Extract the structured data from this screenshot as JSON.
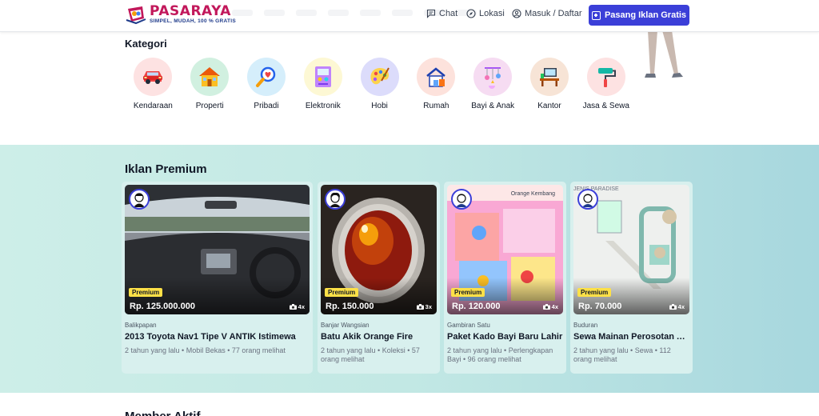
{
  "header": {
    "logo_title": "PASARAYA",
    "logo_tagline": "SIMPEL, MUDAH, 100 % GRATIS",
    "chat": "Chat",
    "lokasi": "Lokasi",
    "login": "Masuk / Daftar",
    "cta": "Pasang Iklan Gratis"
  },
  "kategori": {
    "title": "Kategori",
    "items": [
      {
        "label": "Kendaraan",
        "icon": "car-icon"
      },
      {
        "label": "Properti",
        "icon": "house-icon"
      },
      {
        "label": "Pribadi",
        "icon": "magnifier-heart-icon"
      },
      {
        "label": "Elektronik",
        "icon": "electronics-icon"
      },
      {
        "label": "Hobi",
        "icon": "palette-icon"
      },
      {
        "label": "Rumah",
        "icon": "home-tools-icon"
      },
      {
        "label": "Bayi & Anak",
        "icon": "baby-mobile-icon"
      },
      {
        "label": "Kantor",
        "icon": "desk-icon"
      },
      {
        "label": "Jasa & Sewa",
        "icon": "paint-roller-icon"
      }
    ]
  },
  "premium": {
    "title": "Iklan Premium",
    "cards": [
      {
        "badge": "Premium",
        "price": "Rp. 125.000.000",
        "photos": "4x",
        "location": "Balikpapan",
        "title": "2013 Toyota Nav1 Tipe V ANTIK Istimewa",
        "meta": "2 tahun yang lalu • Mobil Bekas • 77 orang melihat"
      },
      {
        "badge": "Premium",
        "price": "Rp. 150.000",
        "photos": "3x",
        "location": "Banjar Wangsian",
        "title": "Batu Akik Orange Fire",
        "meta": "2 tahun yang lalu • Koleksi • 57 orang melihat"
      },
      {
        "badge": "Premium",
        "price": "Rp. 120.000",
        "photos": "4x",
        "location": "Gambiran Satu",
        "title": "Paket Kado Bayi Baru Lahir",
        "meta": "2 tahun yang lalu • Perlengkapan Bayi • 96 orang melihat",
        "image_caption": "Orange Kembang"
      },
      {
        "badge": "Premium",
        "price": "Rp. 70.000",
        "photos": "4x",
        "location": "Buduran",
        "title": "Sewa Mainan Perosotan Anak",
        "meta": "2 tahun yang lalu • Sewa • 112 orang melihat",
        "image_caption": "JENIS PARADISE"
      }
    ]
  },
  "member": {
    "title": "Member Aktif"
  },
  "colors": {
    "primary": "#3b3fd8",
    "brand": "#c2185b",
    "badge": "#fde047"
  }
}
